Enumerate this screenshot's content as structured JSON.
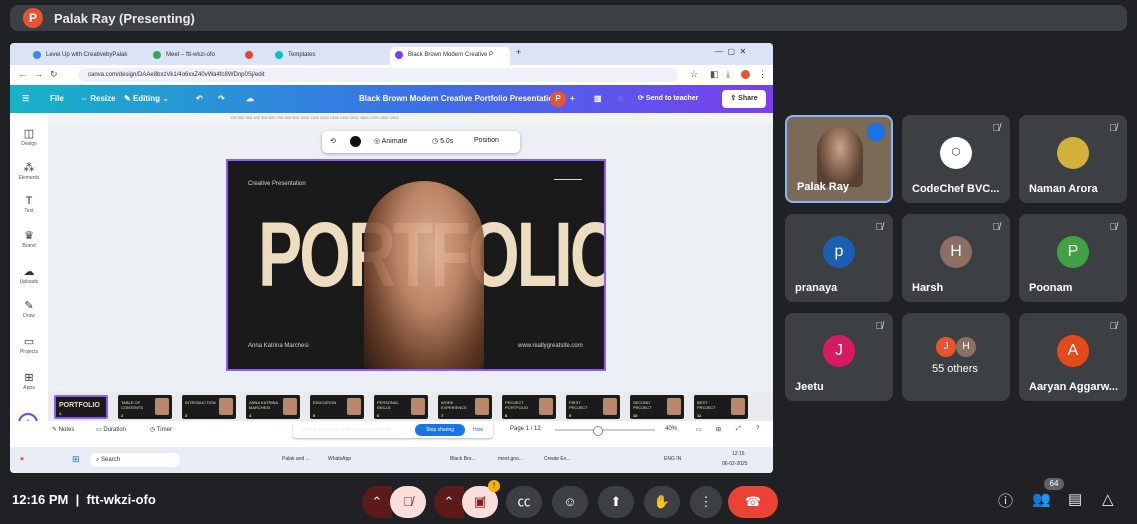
{
  "presenter": {
    "initial": "P",
    "name": "Palak Ray (Presenting)"
  },
  "browser": {
    "tabs": [
      "Level Up with CreativebyPalak",
      "Meet – ftt-wkzi-ofo",
      "",
      "Templates",
      "Black Brown Modern Creative P"
    ],
    "url": "canva.com/design/DAAe8bxzVk1/4o6xxZ40vWa4fc8WDnp0Sj/edit"
  },
  "canva": {
    "menu": [
      "File",
      "Resize",
      "Editing"
    ],
    "title": "Black Brown Modern Creative Portfolio Presentation",
    "avatar": "P",
    "send": "Send to teacher",
    "share": "Share",
    "rail": [
      "Design",
      "Elements",
      "Text",
      "Brand",
      "Uploads",
      "Draw",
      "Projects",
      "Apps"
    ],
    "toolbar": {
      "animate": "Animate",
      "duration": "5.0s",
      "position": "Position"
    },
    "ruler": "100 200 300 400 500 600 700 800 900 1000 1100 1200 1300 1400 1500 1600 1700 1800 1900"
  },
  "slide": {
    "top_left": "Creative Presentation",
    "headline": "PORTFOLIO",
    "name": "Anna Katrina Marchesi",
    "site": "www.reallygreatsite.com"
  },
  "thumbnails": [
    {
      "label": "PORTFOLIO",
      "num": "1"
    },
    {
      "label": "TABLE OF CONTENTS",
      "num": "2"
    },
    {
      "label": "INTRODUCTION",
      "num": "3"
    },
    {
      "label": "ANNA KATRINA MARCHESI",
      "num": "4"
    },
    {
      "label": "EDUCATION",
      "num": "5"
    },
    {
      "label": "PERSONAL SKILLS",
      "num": "6"
    },
    {
      "label": "WORK EXPERIENCE",
      "num": "7"
    },
    {
      "label": "PROJECT PORTFOLIO",
      "num": "8"
    },
    {
      "label": "FIRST PROJECT",
      "num": "9"
    },
    {
      "label": "SECOND PROJECT",
      "num": "10"
    },
    {
      "label": "BEST PROJECT",
      "num": "11"
    }
  ],
  "editor_bottom": {
    "notes": "Notes",
    "duration": "Duration",
    "timer": "Timer",
    "sharing_msg": "meet.google.com is sharing your screen.",
    "stop": "Stop sharing",
    "hide": "Hide",
    "page": "Page 1 / 12",
    "zoom": "40%"
  },
  "taskbar": {
    "search": "Search",
    "items": [
      "Palak and ...",
      "WhatsApp",
      "Black Bro...",
      "meet.goo...",
      "Create Ev..."
    ],
    "lang": "ENG IN",
    "clock": "12:15",
    "date": "06-02-2025"
  },
  "participants": [
    {
      "name": "Palak Ray",
      "initial": "",
      "color": "#7b6a58",
      "speaking": true
    },
    {
      "name": "CodeChef BVC...",
      "initial": "",
      "color": "#ffffff"
    },
    {
      "name": "Naman Arora",
      "initial": "",
      "color": "#d4b13a"
    },
    {
      "name": "pranaya",
      "initial": "p",
      "color": "#1a5fb4"
    },
    {
      "name": "Harsh",
      "initial": "H",
      "color": "#8d6e63"
    },
    {
      "name": "Poonam",
      "initial": "P",
      "color": "#43a047"
    },
    {
      "name": "Jeetu",
      "initial": "J",
      "color": "#d81b60"
    },
    {
      "name": "55 others",
      "initial": "",
      "color": "#e8542f"
    },
    {
      "name": "Aaryan Aggarw...",
      "initial": "A",
      "color": "#e64a19"
    }
  ],
  "others_initials": [
    "J",
    "H"
  ],
  "meeting": {
    "time": "12:16 PM",
    "code": "ftt-wkzi-ofo",
    "people_count": "64",
    "notification": "!"
  }
}
